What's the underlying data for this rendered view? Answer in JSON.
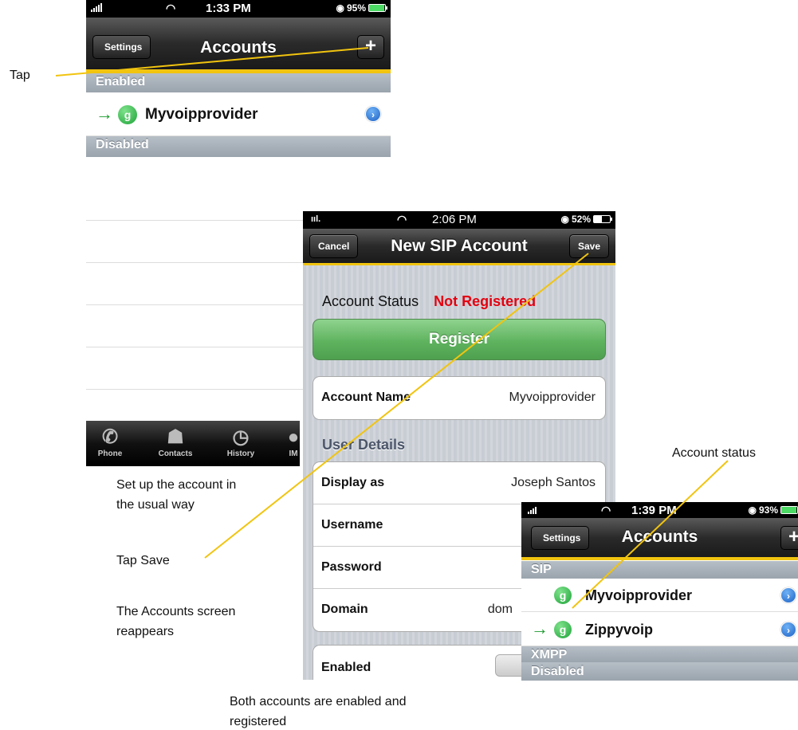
{
  "screen1": {
    "status": {
      "time": "1:33 PM",
      "battery": "95%"
    },
    "nav": {
      "back_label": "Settings",
      "title": "Accounts",
      "add_label": "+"
    },
    "sections": {
      "enabled": "Enabled",
      "disabled": "Disabled"
    },
    "accounts": [
      {
        "name": "Myvoipprovider",
        "icon": "g"
      }
    ]
  },
  "background_list": {
    "tabs": [
      {
        "label": "Phone",
        "icon": "phone-icon",
        "glyph": "✆"
      },
      {
        "label": "Contacts",
        "icon": "person-icon",
        "glyph": "☗"
      },
      {
        "label": "History",
        "icon": "clock-icon",
        "glyph": "◷"
      },
      {
        "label": "IM",
        "icon": "chat-bubble-icon",
        "glyph": "●"
      }
    ]
  },
  "screen2": {
    "status": {
      "carrier": "ııl.",
      "time": "2:06 PM",
      "battery": "52%"
    },
    "nav": {
      "cancel_label": "Cancel",
      "title": "New SIP Account",
      "save_label": "Save"
    },
    "account_status": {
      "label": "Account Status",
      "value": "Not Registered",
      "value_color": "#e4000f"
    },
    "register_label": "Register",
    "account_name": {
      "label": "Account Name",
      "value": "Myvoipprovider"
    },
    "user_details_header": "User Details",
    "user_fields": [
      {
        "label": "Display as",
        "value": "Joseph Santos"
      },
      {
        "label": "Username",
        "value": ""
      },
      {
        "label": "Password",
        "value": ""
      },
      {
        "label": "Domain",
        "value": "dom"
      }
    ],
    "enabled_label": "Enabled"
  },
  "screen3": {
    "status": {
      "time": "1:39 PM",
      "battery": "93%"
    },
    "nav": {
      "back_label": "Settings",
      "title": "Accounts",
      "add_label": "+"
    },
    "sections": {
      "sip": "SIP",
      "xmpp": "XMPP",
      "disabled": "Disabled"
    },
    "accounts": [
      {
        "name": "Myvoipprovider",
        "icon": "g"
      },
      {
        "name": "Zippyvoip",
        "icon": "g"
      }
    ]
  },
  "annotations": {
    "tap": "Tap",
    "setup_line1": "Set up the account in",
    "setup_line2": "the usual way",
    "tap_save": "Tap Save",
    "reappears_line1": "The Accounts screen",
    "reappears_line2": "reappears",
    "account_status": "Account status",
    "both_line1": "Both accounts are enabled and",
    "both_line2": "registered"
  },
  "colors": {
    "accent_yellow": "#f1c40f",
    "green_arrow": "#1b9b2d",
    "not_registered": "#e4000f"
  }
}
